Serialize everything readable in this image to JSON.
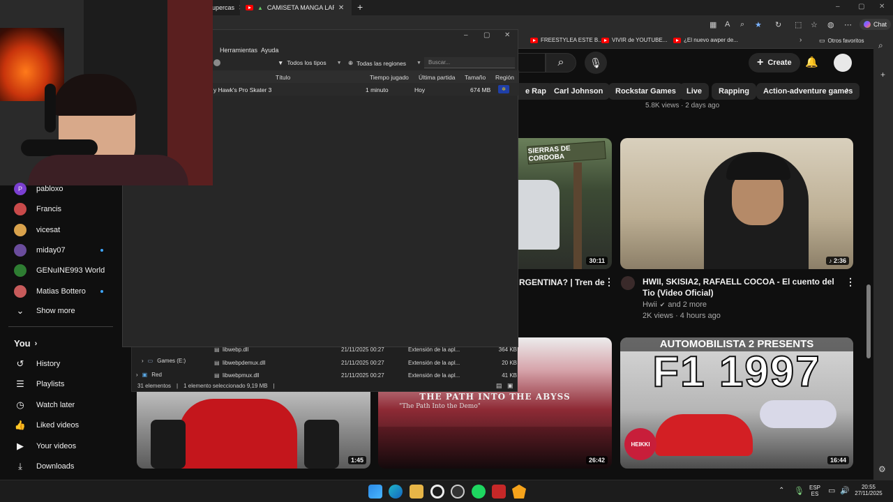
{
  "browser": {
    "tabs": [
      {
        "label": "upercas"
      },
      {
        "label": "CAMISETA MANGA LARGA"
      }
    ],
    "new_tab": "+",
    "window_controls": [
      "–",
      "▢",
      "✕"
    ],
    "chat_label": "Chat",
    "bookmarks": [
      {
        "label": "FREESTYLEA ESTE B..."
      },
      {
        "label": "VIVIR de YOUTUBE..."
      },
      {
        "label": "¿El nuevo awper de..."
      }
    ],
    "other_favorites": "Otros favoritos"
  },
  "youtube": {
    "create_label": "Create",
    "chips": [
      "e Rap",
      "Carl Johnson",
      "Rockstar Games",
      "Live",
      "Rapping",
      "Action-adventure games"
    ],
    "partial_meta": "5.8K views · 2 days ago",
    "videos": [
      {
        "title": "RGENTINA? | Tren de",
        "duration": "30:11",
        "thumb_text": "SIERRAS DE CORDOBA"
      },
      {
        "title": "HWII, SKISIA2, RAFAELL COCOA - El cuento del Tio (Video Oficial)",
        "channel": "Hwii",
        "channel_extra": "and 2 more",
        "meta": "2K views · 4 hours ago",
        "duration": "♪ 2:36"
      },
      {
        "duration": "1:45"
      },
      {
        "duration": "26:42",
        "thumb_title": "THE PATH INTO THE ABYSS",
        "thumb_sub": "\"The Path Into the Demo\""
      },
      {
        "duration": "16:44",
        "thumb_title": "AUTOMOBILISTA 2 PRESENTS",
        "thumb_big": "F1 1997",
        "badge": "HEIKKI"
      }
    ],
    "sidebar": {
      "subscriptions": [
        {
          "name": "pabloxo",
          "initial": "P",
          "color": "#7b3fd1"
        },
        {
          "name": "Francis",
          "color": "#c94a4a"
        },
        {
          "name": "vicesat",
          "color": "#d9a24c"
        },
        {
          "name": "miday07",
          "color": "#6a4c9c",
          "live": true
        },
        {
          "name": "GENuINE993 World",
          "color": "#2e7d32"
        },
        {
          "name": "Matias Bottero",
          "color": "#c75b5b",
          "live": true
        }
      ],
      "show_more": "Show more",
      "you_label": "You",
      "you_items": [
        {
          "label": "History",
          "icon": "history-icon",
          "glyph": "↺"
        },
        {
          "label": "Playlists",
          "icon": "playlists-icon",
          "glyph": "☰"
        },
        {
          "label": "Watch later",
          "icon": "watch-later-icon",
          "glyph": "◷"
        },
        {
          "label": "Liked videos",
          "icon": "thumbs-up-icon",
          "glyph": "👍"
        },
        {
          "label": "Your videos",
          "icon": "your-videos-icon",
          "glyph": "▶"
        },
        {
          "label": "Downloads",
          "icon": "download-icon",
          "glyph": "⤓"
        }
      ]
    }
  },
  "launcher": {
    "menu": [
      "Herramientas",
      "Ayuda"
    ],
    "filters": {
      "type": "Todos los tipos",
      "region": "Todas las regiones",
      "search_placeholder": "Buscar..."
    },
    "columns": [
      "Título",
      "Tiempo jugado",
      "Última partida",
      "Tamaño",
      "Región"
    ],
    "rows": [
      {
        "title": "y Hawk's Pro Skater 3",
        "played": "1 minuto",
        "last": "Hoy",
        "size": "674 MB"
      }
    ]
  },
  "explorer": {
    "tree": [
      "Games (E:)",
      "Red"
    ],
    "files": [
      {
        "name": "libwebp.dll",
        "date": "21/11/2025 00:27",
        "type": "Extensión de la apl...",
        "size": "364 KB"
      },
      {
        "name": "libwebpdemux.dll",
        "date": "21/11/2025 00:27",
        "type": "Extensión de la apl...",
        "size": "20 KB"
      },
      {
        "name": "libwebpmux.dll",
        "date": "21/11/2025 00:27",
        "type": "Extensión de la apl...",
        "size": "41 KB"
      }
    ],
    "status_count": "31 elementos",
    "status_selected": "1 elemento seleccionado  9,19 MB"
  },
  "taskbar": {
    "lang1": "ESP",
    "lang2": "ES",
    "time": "20:55",
    "date": "27/11/2025"
  }
}
